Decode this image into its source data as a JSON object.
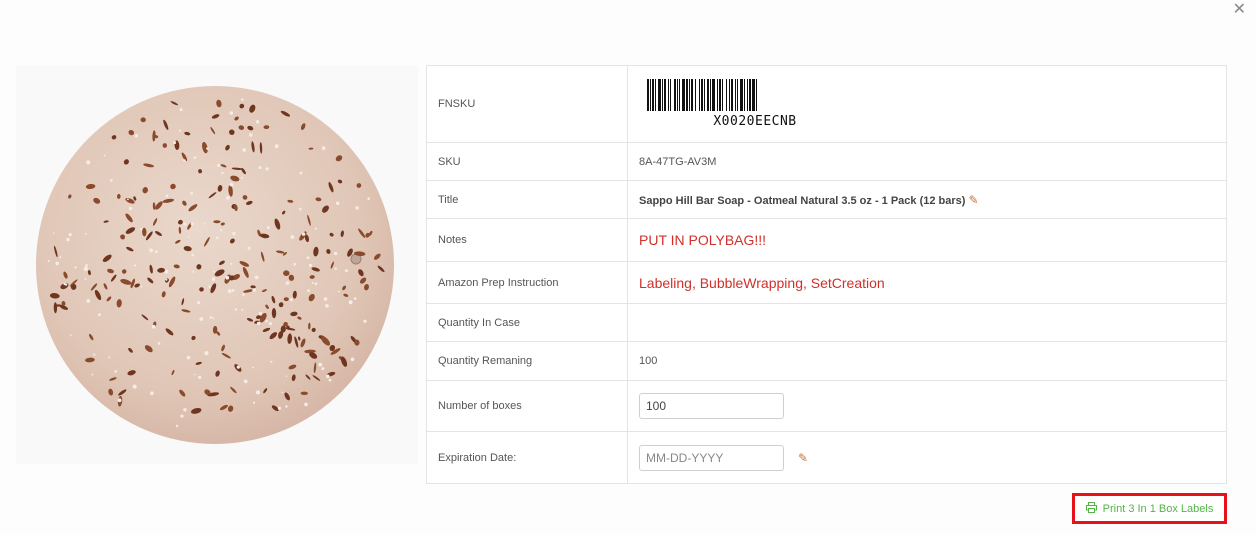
{
  "details": [
    {
      "key": "fnsku",
      "label": "FNSKU",
      "barcode_text": "X0020EECNB"
    },
    {
      "key": "sku",
      "label": "SKU",
      "value": "8A-47TG-AV3M"
    },
    {
      "key": "title",
      "label": "Title",
      "value": "Sappo Hill Bar Soap - Oatmeal Natural 3.5 oz - 1 Pack (12 bars)"
    },
    {
      "key": "notes",
      "label": "Notes",
      "value": "PUT IN POLYBAG!!!"
    },
    {
      "key": "prep",
      "label": "Amazon Prep Instruction",
      "value": "Labeling, BubbleWrapping, SetCreation"
    },
    {
      "key": "qty_case",
      "label": "Quantity In Case",
      "value": ""
    },
    {
      "key": "qty_remaining",
      "label": "Quantity Remaning",
      "value": "100"
    },
    {
      "key": "boxes",
      "label": "Number of boxes",
      "value": "100"
    },
    {
      "key": "expiration",
      "label": "Expiration Date:",
      "placeholder": "MM-DD-YYYY"
    }
  ],
  "actions": {
    "print_label": "Print 3 In 1 Box Labels"
  },
  "icons": {
    "close": "close-icon",
    "edit": "pencil-icon",
    "print": "printer-icon"
  },
  "colors": {
    "accent_red": "#d0302a",
    "button_green": "#52b447",
    "highlight_border": "#e8111a"
  }
}
